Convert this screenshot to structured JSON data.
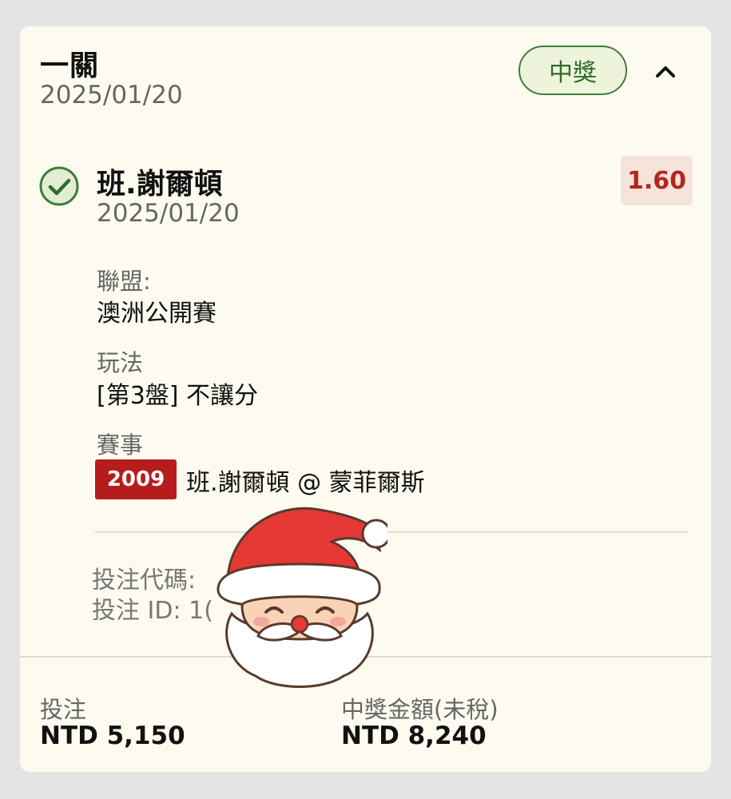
{
  "header": {
    "bet_type": "一關",
    "date": "2025/01/20",
    "status": "中獎"
  },
  "selection": {
    "name": "班.謝爾頓",
    "date": "2025/01/20",
    "odds": "1.60",
    "result_icon": "check-circle-icon",
    "league_label": "聯盟:",
    "league": "澳洲公開賽",
    "market_label": "玩法",
    "market": "[第3盤] 不讓分",
    "event_label": "賽事",
    "event_code": "2009",
    "event_teams": "班.謝爾頓 @ 蒙菲爾斯"
  },
  "meta": {
    "bet_code_label": "投注代碼:",
    "bet_id_label": "投注 ID: 1("
  },
  "footer": {
    "stake_label": "投注",
    "stake_value": "NTD 5,150",
    "payout_label": "中獎金額(未稅)",
    "payout_value": "NTD 8,240"
  },
  "colors": {
    "card_bg": "#fdfbef",
    "win_green": "#3f7c3b",
    "odds_red": "#b3261e",
    "code_red": "#b71c1c"
  },
  "decoration": "santa-sticker"
}
